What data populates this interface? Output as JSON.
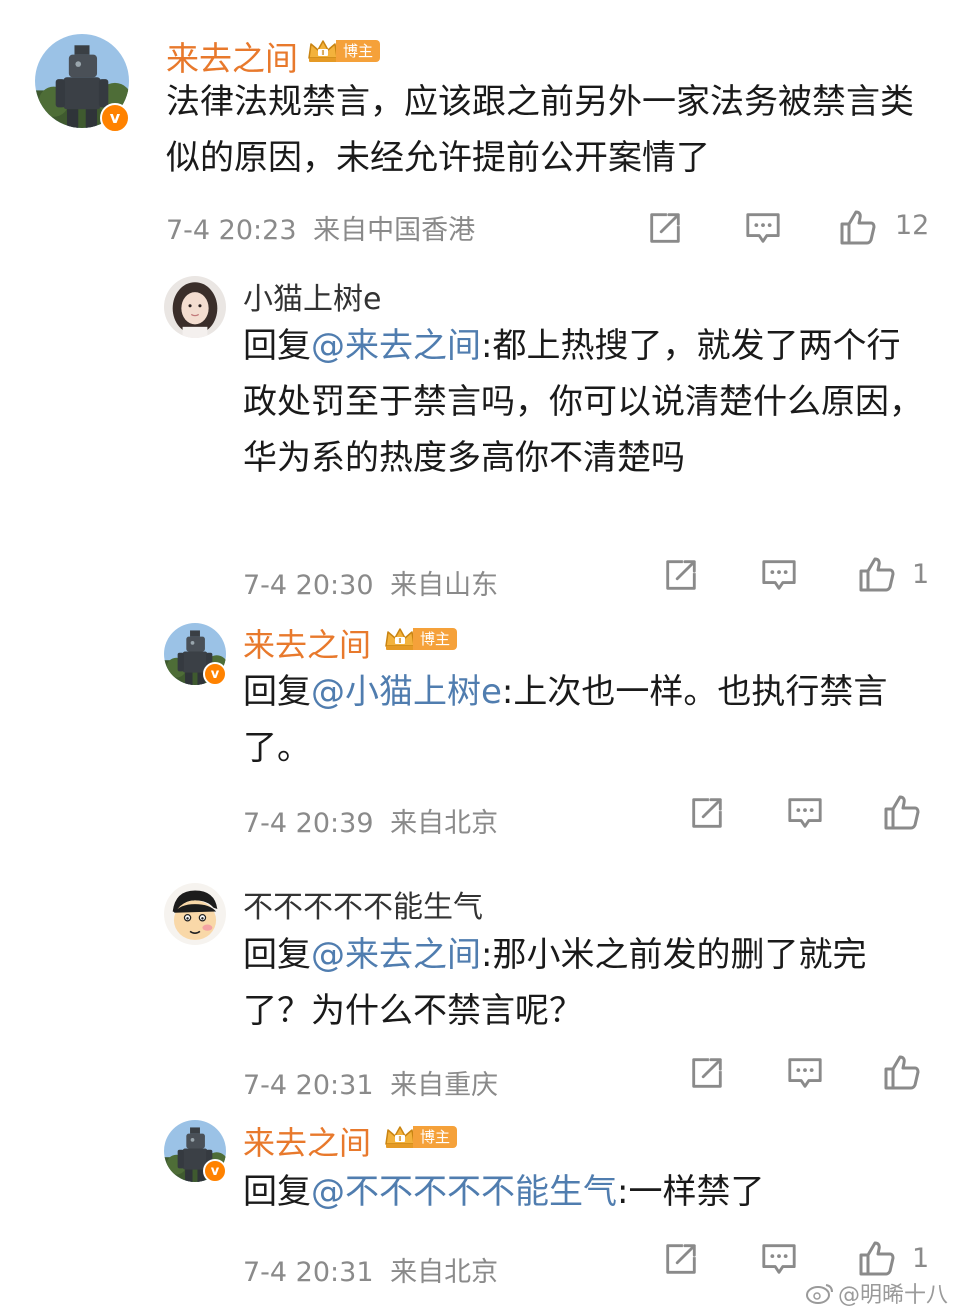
{
  "colors": {
    "author": "#e8792c",
    "mention": "#507daf",
    "meta": "#8a8a8a",
    "badge": "#ff8200"
  },
  "comment_main": {
    "name": "来去之间",
    "badge": "博主",
    "text": "法律法规禁言，应该跟之前另外一家法务被禁言类似的原因，未经允许提前公开案情了",
    "time": "7-4 20:23",
    "location": "来自中国香港",
    "likes": "12",
    "verified_mark": "v"
  },
  "replies": [
    {
      "name": "小猫上树e",
      "reply_prefix": "回复",
      "mention": "@来去之间",
      "colon": ":",
      "text": "都上热搜了，就发了两个行政处罚至于禁言吗，你可以说清楚什么原因，华为系的热度多高你不清楚吗",
      "time": "7-4 20:30",
      "location": "来自山东",
      "likes": "1"
    },
    {
      "name": "来去之间",
      "badge": "博主",
      "reply_prefix": "回复",
      "mention": "@小猫上树e",
      "colon": ":",
      "text": "上次也一样。也执行禁言了。",
      "time": "7-4 20:39",
      "location": "来自北京",
      "likes": ""
    },
    {
      "name": "不不不不不能生气",
      "reply_prefix": "回复",
      "mention": "@来去之间",
      "colon": ":",
      "text": "那小米之前发的删了就完了？为什么不禁言呢？",
      "time": "7-4 20:31",
      "location": "来自重庆",
      "likes": ""
    },
    {
      "name": "来去之间",
      "badge": "博主",
      "reply_prefix": "回复",
      "mention": "@不不不不不能生气",
      "colon": ":",
      "text": "一样禁了",
      "time": "7-4 20:31",
      "location": "来自北京",
      "likes": "1"
    }
  ],
  "watermark": {
    "text": "@明晞十八",
    "icon": "weibo-logo-icon"
  },
  "icons": {
    "share": "share-icon",
    "comment": "comment-icon",
    "like": "like-icon",
    "crown": "crown-icon"
  }
}
